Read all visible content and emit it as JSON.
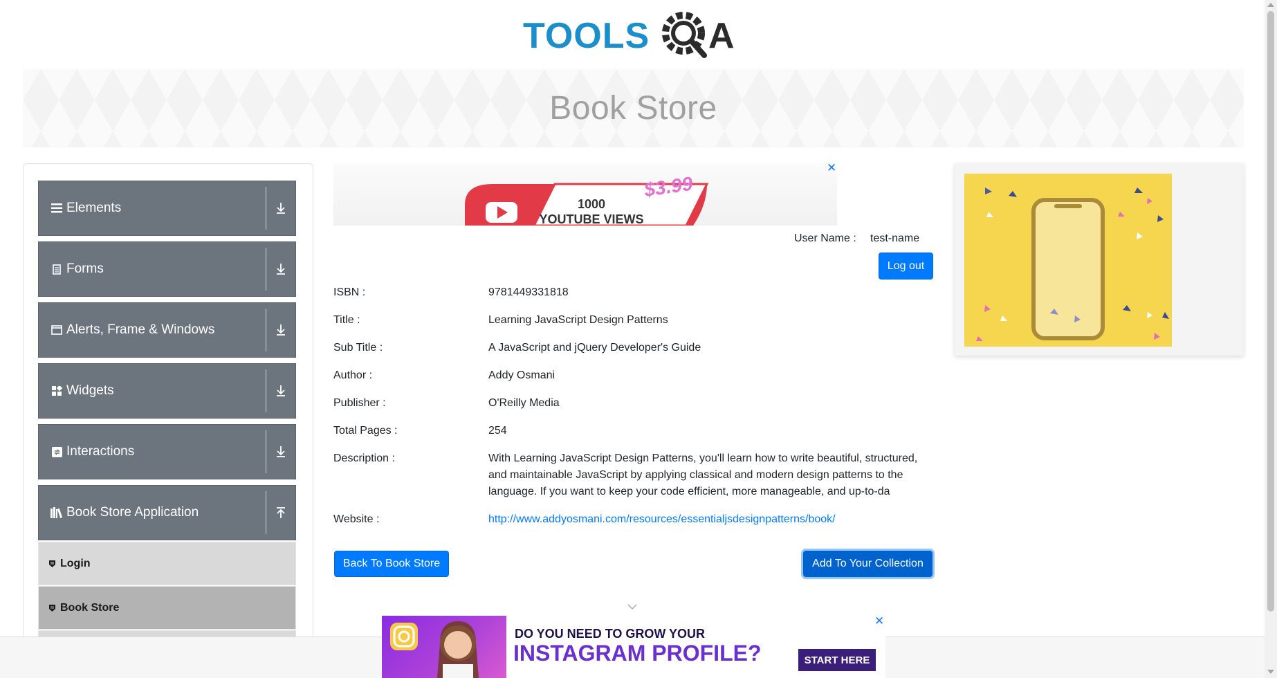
{
  "header": {
    "logo_text_left": "TOOLS",
    "logo_text_right": "A"
  },
  "banner": {
    "title": "Book Store"
  },
  "sidebar": {
    "groups": [
      {
        "label": "Elements",
        "icon": "hamburger-icon",
        "expanded": false
      },
      {
        "label": "Forms",
        "icon": "document-icon",
        "expanded": false
      },
      {
        "label": "Alerts, Frame & Windows",
        "icon": "window-icon",
        "expanded": false
      },
      {
        "label": "Widgets",
        "icon": "widgets-icon",
        "expanded": false
      },
      {
        "label": "Interactions",
        "icon": "interactions-icon",
        "expanded": false
      },
      {
        "label": "Book Store Application",
        "icon": "books-icon",
        "expanded": true
      }
    ],
    "subitems": [
      {
        "label": "Login",
        "active": false
      },
      {
        "label": "Book Store",
        "active": true
      }
    ]
  },
  "ad_top": {
    "views_line1": "1000",
    "views_line2": "YOUTUBE VIEWS",
    "price": "$3.99"
  },
  "user": {
    "label": "User Name :",
    "value": "test-name",
    "logout_label": "Log out"
  },
  "book": {
    "fields": [
      {
        "label": "ISBN :",
        "value": "9781449331818"
      },
      {
        "label": "Title :",
        "value": "Learning JavaScript Design Patterns"
      },
      {
        "label": "Sub Title :",
        "value": "A JavaScript and jQuery Developer's Guide"
      },
      {
        "label": "Author :",
        "value": "Addy Osmani"
      },
      {
        "label": "Publisher :",
        "value": "O'Reilly Media"
      },
      {
        "label": "Total Pages :",
        "value": "254"
      }
    ],
    "description_label": "Description :",
    "description": "With Learning JavaScript Design Patterns, you'll learn how to write beautiful, structured, and maintainable JavaScript by applying classical and modern design patterns to the language. If you want to keep your code efficient, more manageable, and up-to-da",
    "website_label": "Website :",
    "website": "http://www.addyosmani.com/resources/essentialjsdesignpatterns/book/"
  },
  "actions": {
    "back_label": "Back To Book Store",
    "add_label": "Add To Your Collection"
  },
  "ad_bottom": {
    "line1": "DO YOU NEED TO GROW YOUR",
    "line2": "INSTAGRAM PROFILE?",
    "cta": "START HERE"
  },
  "colors": {
    "primary": "#007bff",
    "sidebar_group": "#6c757d",
    "logo_blue": "#1b8fce",
    "logo_dark": "#2b2b2b"
  }
}
